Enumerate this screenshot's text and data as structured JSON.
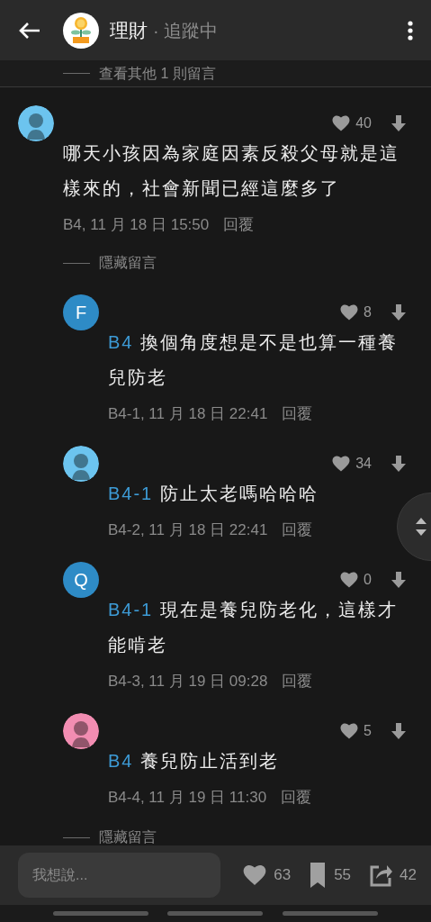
{
  "header": {
    "title": "理財",
    "separator": "·",
    "status": "追蹤中"
  },
  "more_link": "查看其他 1 則留言",
  "comments": [
    {
      "avatar": {
        "kind": "silhouette",
        "color": "#6cc4ef"
      },
      "likes": "40",
      "text": "哪天小孩因為家庭因素反殺父母就是這樣來的，社會新聞已經這麼多了",
      "meta": "B4, 11 月 18 日 15:50",
      "reply": "回覆",
      "toggle": "隱藏留言",
      "replies": [
        {
          "avatar": {
            "kind": "letter",
            "letter": "F",
            "color": "#2e8bc6"
          },
          "likes": "8",
          "mention": "B4",
          "text": "換個角度想是不是也算一種養兒防老",
          "meta": "B4-1, 11 月 18 日 22:41",
          "reply": "回覆"
        },
        {
          "avatar": {
            "kind": "silhouette",
            "color": "#6cc4ef"
          },
          "likes": "34",
          "mention": "B4-1",
          "text": "防止太老嗎哈哈哈",
          "meta": "B4-2, 11 月 18 日 22:41",
          "reply": "回覆"
        },
        {
          "avatar": {
            "kind": "letter",
            "letter": "Q",
            "color": "#2e8bc6"
          },
          "likes": "0",
          "mention": "B4-1",
          "text": "現在是養兒防老化，這樣才能啃老",
          "meta": "B4-3, 11 月 19 日 09:28",
          "reply": "回覆"
        },
        {
          "avatar": {
            "kind": "silhouette",
            "color": "#f28db2"
          },
          "likes": "5",
          "mention": "B4",
          "text": "養兒防止活到老",
          "meta": "B4-4, 11 月 19 日 11:30",
          "reply": "回覆"
        }
      ],
      "footer_toggle": "隱藏留言"
    }
  ],
  "composer": {
    "placeholder": "我想說..."
  },
  "stats": [
    {
      "kind": "like",
      "count": "63"
    },
    {
      "kind": "bookmark",
      "count": "55"
    },
    {
      "kind": "share",
      "count": "42"
    }
  ]
}
